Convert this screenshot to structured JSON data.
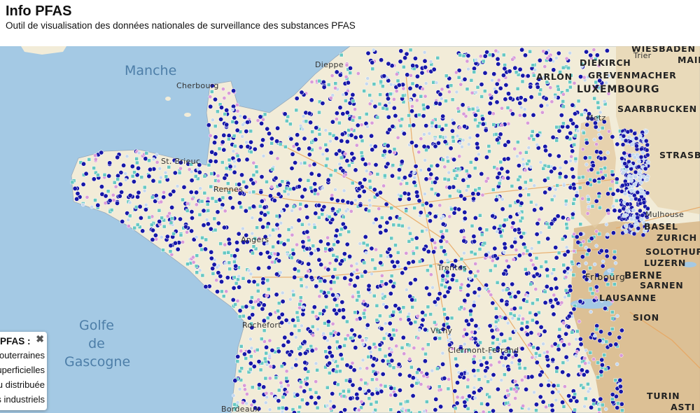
{
  "header": {
    "title": "Info PFAS",
    "subtitle": "Outil de visualisation des données nationales de surveillance des substances PFAS"
  },
  "map": {
    "seas": [
      "Manche",
      "Golfe\nde\nGascogne"
    ],
    "cities": {
      "small": [
        "Cherbourg",
        "Dieppe",
        "St. Brieuc",
        "Rennes",
        "Angers",
        "Rochefort",
        "Bordeaux",
        "Metz",
        "Fribourg",
        "Vichy",
        "Clermont-Ferrand",
        "Trier",
        "Trentes"
      ],
      "big": [
        "WIESBADEN",
        "MAINZ",
        "DIEKIRCH",
        "ARLON",
        "GREVENMACHER",
        "LUXEMBOURG",
        "SAARBRUCKEN",
        "STRASBOURG",
        "Mulhouse",
        "BASEL",
        "ZURICH",
        "SOLOTHURN",
        "LUZERN",
        "BERNE",
        "SARNEN",
        "LAUSANNE",
        "SION",
        "TURIN",
        "ASTI"
      ]
    },
    "colors": {
      "sea": "#a4c9e4",
      "land": "#f2ecd8",
      "mountain": "#d8b889",
      "dot_dark": "#1717a8",
      "dot_teal": "#66c8c2",
      "dot_pink": "#d99ad9",
      "dot_light": "#c5d8ef"
    }
  },
  "legend": {
    "title": "PFAS :",
    "close_icon": "close-icon",
    "items": [
      "Eaux souterraines",
      "Eaux superficielles",
      "Eau distribuée",
      "Rejets industriels"
    ]
  }
}
